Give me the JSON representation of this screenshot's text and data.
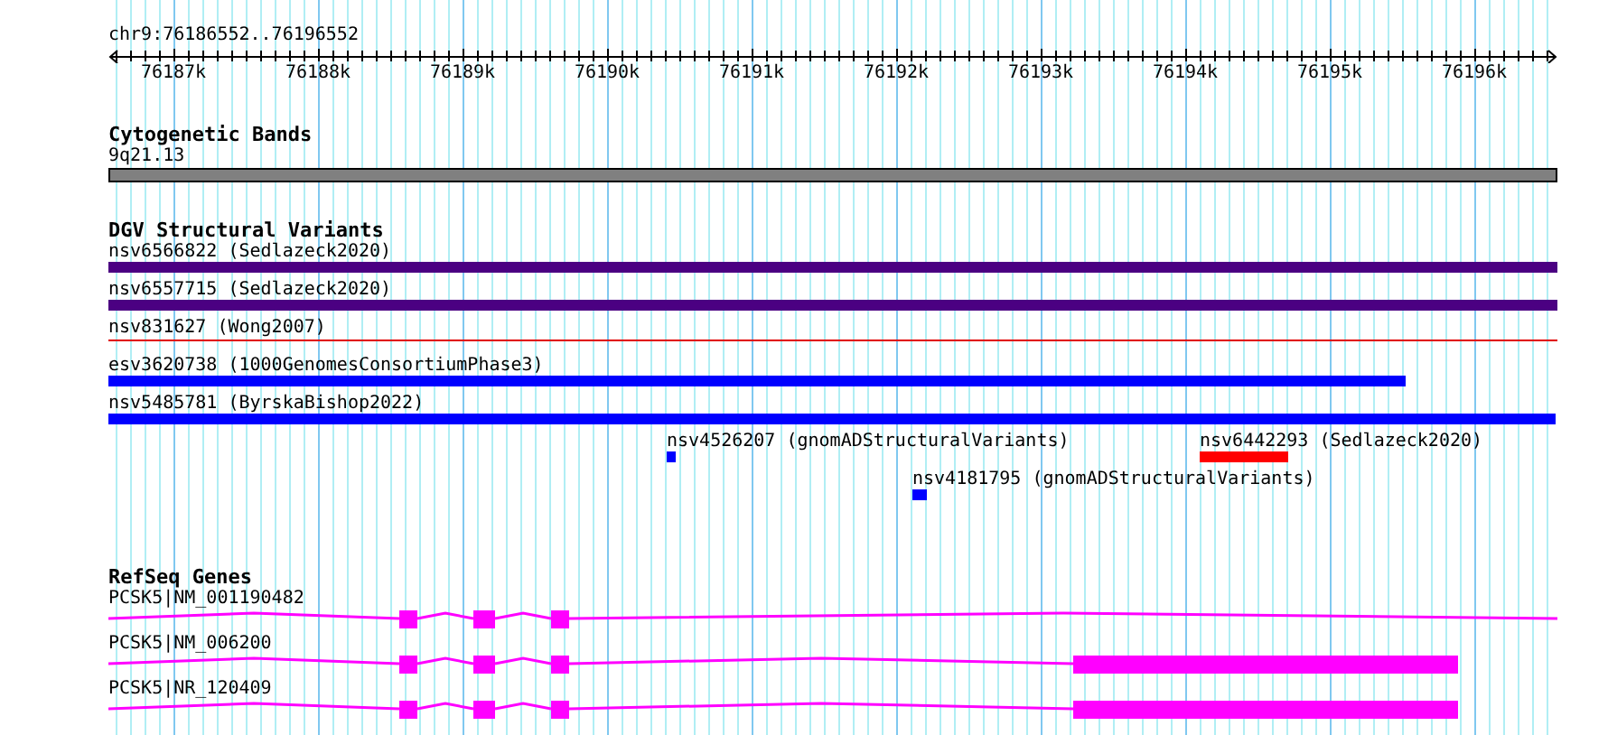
{
  "scale": {
    "label": "chr9:76186552..76196552",
    "ticks": [
      "76187k",
      "76188k",
      "76189k",
      "76190k",
      "76191k",
      "76192k",
      "76193k",
      "76194k",
      "76195k",
      "76196k"
    ]
  },
  "cytogenetic_bands": {
    "title": "Cytogenetic Bands",
    "band": {
      "label": "9q21.13",
      "color": "#808080"
    }
  },
  "dgv_structural_variants": {
    "title": "DGV Structural Variants",
    "rows": [
      [
        {
          "kind": "bar",
          "label": "nsv6566822 (Sedlazeck2020)",
          "color": "#4b0082"
        }
      ],
      [
        {
          "kind": "bar",
          "label": "nsv6557715 (Sedlazeck2020)",
          "color": "#4b0082"
        }
      ],
      [
        {
          "kind": "line",
          "label": "nsv831627 (Wong2007)",
          "color": "#e00000"
        }
      ],
      [
        {
          "kind": "bar",
          "label": "esv3620738 (1000GenomesConsortiumPhase3)",
          "color": "#0000ff"
        }
      ],
      [
        {
          "kind": "bar",
          "label": "nsv5485781 (ByrskaBishop2022)",
          "color": "#0000ff"
        }
      ],
      [
        {
          "kind": "bar",
          "label": "nsv4526207 (gnomADStructuralVariants)",
          "color": "#0000ff"
        },
        {
          "kind": "bar",
          "label": "nsv6442293 (Sedlazeck2020)",
          "color": "#ff0000"
        }
      ],
      [
        {
          "kind": "bar",
          "label": "nsv4181795 (gnomADStructuralVariants)",
          "color": "#0000ff"
        }
      ]
    ]
  },
  "refseq_genes": {
    "title": "RefSeq Genes",
    "genes": [
      {
        "label": "PCSK5|NM_001190482"
      },
      {
        "label": "PCSK5|NM_006200"
      },
      {
        "label": "PCSK5|NR_120409"
      }
    ]
  }
}
